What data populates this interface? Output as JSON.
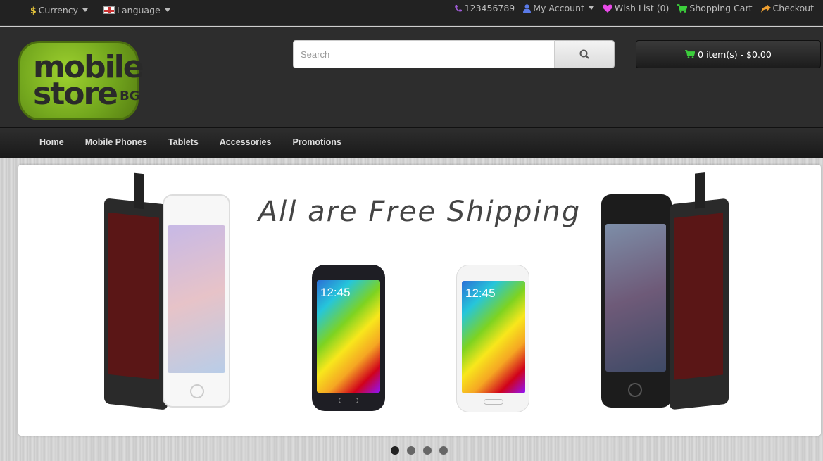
{
  "topbar": {
    "currency": "Currency",
    "currency_symbol": "$",
    "language": "Language",
    "phone": "123456789",
    "account": "My Account",
    "wishlist": "Wish List (0)",
    "cart": "Shopping Cart",
    "checkout": "Checkout"
  },
  "logo": {
    "line1": "mobile",
    "line2": "store",
    "tag": "BG"
  },
  "search": {
    "placeholder": "Search"
  },
  "cart": {
    "label": "0 item(s) - $0.00"
  },
  "nav": {
    "items": [
      "Home",
      "Mobile Phones",
      "Tablets",
      "Accessories",
      "Promotions"
    ]
  },
  "banner": {
    "title": "All are Free Shipping"
  },
  "phones": {
    "time": "12:45"
  },
  "colors": {
    "phone_icon": "#a05cd8",
    "account_icon": "#5a7ae8",
    "wish_icon": "#e84ae8",
    "cart_icon": "#3ccf3c",
    "checkout_icon": "#f0a030",
    "currency_icon": "#e8c63a",
    "logo_green": "#8cc326"
  },
  "slider": {
    "slide_count": 4,
    "active_index": 0
  }
}
